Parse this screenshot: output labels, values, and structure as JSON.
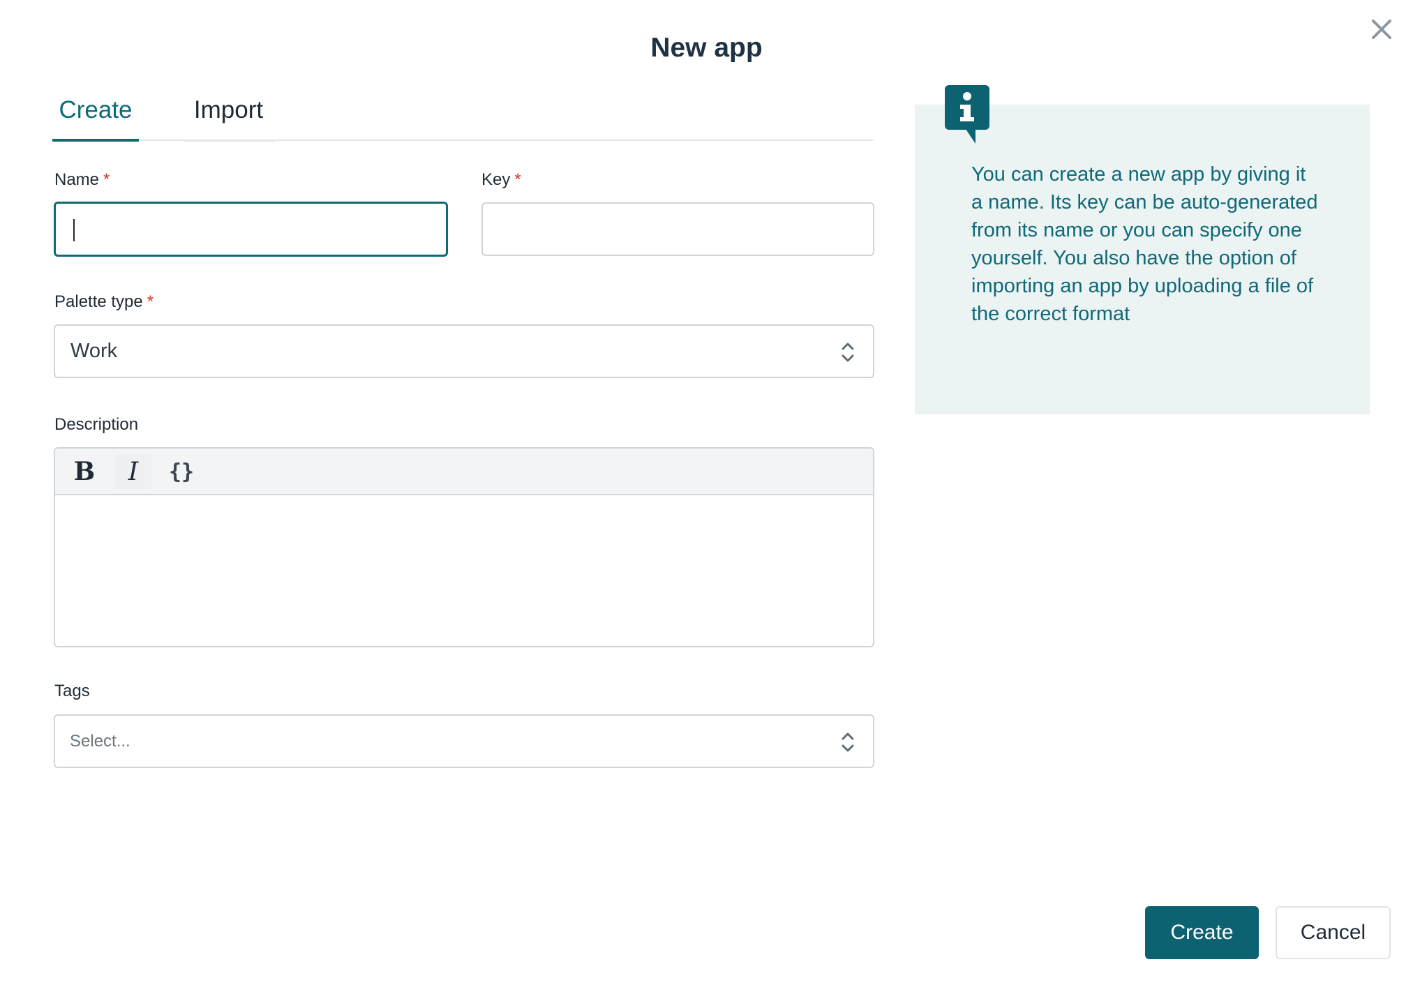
{
  "dialog": {
    "title": "New app"
  },
  "tabs": [
    {
      "label": "Create",
      "active": true
    },
    {
      "label": "Import",
      "active": false
    }
  ],
  "form": {
    "name": {
      "label": "Name",
      "required_mark": "*",
      "value": ""
    },
    "key": {
      "label": "Key",
      "required_mark": "*",
      "value": ""
    },
    "palette_type": {
      "label": "Palette type",
      "required_mark": "*",
      "value": "Work"
    },
    "description": {
      "label": "Description",
      "toolbar": {
        "bold": "B",
        "italic": "I",
        "code": "{}"
      }
    },
    "tags": {
      "label": "Tags",
      "placeholder": "Select..."
    }
  },
  "info_panel": {
    "icon": "info-icon",
    "text": "You can create a new app by giving it a name. Its key can be auto-generated from its name or you can specify one yourself. You also have the option of importing an app by uploading a file of the correct format"
  },
  "actions": {
    "create_label": "Create",
    "cancel_label": "Cancel"
  },
  "colors": {
    "accent": "#0f6a78",
    "primary_button": "#0d6272",
    "info_bg": "#ebf3f3",
    "required": "#d9312b"
  }
}
